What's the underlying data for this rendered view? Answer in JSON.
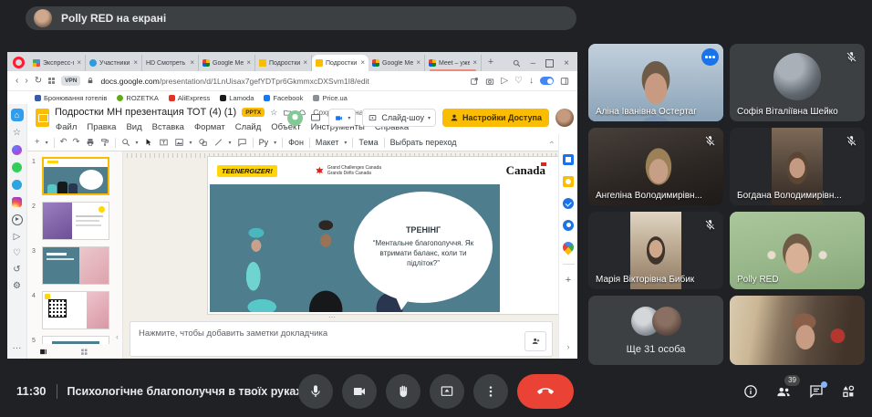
{
  "colors": {
    "meet_bg": "#202124",
    "tile_bg": "#3c4043",
    "accent_blue": "#8ab4f8",
    "button_blue": "#1a73e8",
    "end_call_red": "#ea4335",
    "slides_yellow": "#fbbc04",
    "slide_teal": "#4e7d8d",
    "teenergizer_yellow": "#ffd60a",
    "opera_red": "#ff1b2d"
  },
  "meet": {
    "presenting_banner": "Polly RED на екрані",
    "clock": "11:30",
    "meeting_title": "Психологічне благополуччя в твоїх руках",
    "people_count": "39",
    "tiles": [
      {
        "name": "Аліна Іванівна Остертаг"
      },
      {
        "name": "Софія Віталіївна Шейко"
      },
      {
        "name": "Ангеліна Володимирівн..."
      },
      {
        "name": "Богдана Володимирівн..."
      },
      {
        "name": "Марія Вікторівна Бибик"
      },
      {
        "name": "Polly RED"
      },
      {
        "name": "Ще 31 особа"
      },
      {
        "name": ""
      }
    ]
  },
  "browser": {
    "tabs": [
      {
        "label": "Экспресс-па..."
      },
      {
        "label": "Участники гру..."
      },
      {
        "label": "HD Смотреть фи..."
      },
      {
        "label": "Google Meet"
      },
      {
        "label": "Подростки М..."
      },
      {
        "label": "Подростки М..."
      },
      {
        "label": "Google Meet"
      },
      {
        "label": "Meet – уже..."
      }
    ],
    "vpn_badge": "VPN",
    "url_domain": "docs.google.com",
    "url_path": "/presentation/d/1LnUisax7gefYDTpr6GkmmxcDXSvm1I8/edit",
    "bookmarks": [
      "Бронювання готелів",
      "ROZETKA",
      "AliExpress",
      "Lamoda",
      "Facebook",
      "Price.ua"
    ]
  },
  "slides": {
    "doc_title": "Подростки МН презентация ТОТ (4) (1)",
    "file_badge": "PPTX",
    "saved_status": "Сохранено на Д...",
    "menu": [
      "Файл",
      "Правка",
      "Вид",
      "Вставка",
      "Формат",
      "Слайд",
      "Объект",
      "Инструменты",
      "Справка"
    ],
    "slideshow_button": "Слайд-шоу",
    "share_button": "Настройки Доступа",
    "format_tool": "Рy",
    "toolbar_labels": {
      "background": "Фон",
      "layout": "Макет",
      "theme": "Тема",
      "transition": "Выбрать переход"
    },
    "notes_placeholder": "Нажмите, чтобы добавить заметки докладчика",
    "thumbs": [
      "1",
      "2",
      "3",
      "4",
      "5"
    ]
  },
  "slide": {
    "brand": "TEENERGIZER!",
    "gcc_line1": "Grand Challenges Canada",
    "gcc_line2": "Grands Défis Canada",
    "canada_wordmark": "Canada",
    "bubble_title": "ТРЕНІНГ",
    "bubble_text": "“Ментальне благополуччя. Як втримати баланс, коли ти підліток?”"
  },
  "icons": {
    "back": "‹",
    "forward": "›",
    "reload": "↻",
    "dropdown": "▾",
    "star": "☆",
    "close": "×",
    "minimize": "–",
    "plus": "+",
    "undo": "↶",
    "redo": "↷",
    "home": "⌂",
    "heart": "♡",
    "gear": "⚙",
    "history": "↺",
    "send": "▷",
    "more_h": "···",
    "download": "↓",
    "chevron_right": "›",
    "drag_dots": "⋯"
  }
}
